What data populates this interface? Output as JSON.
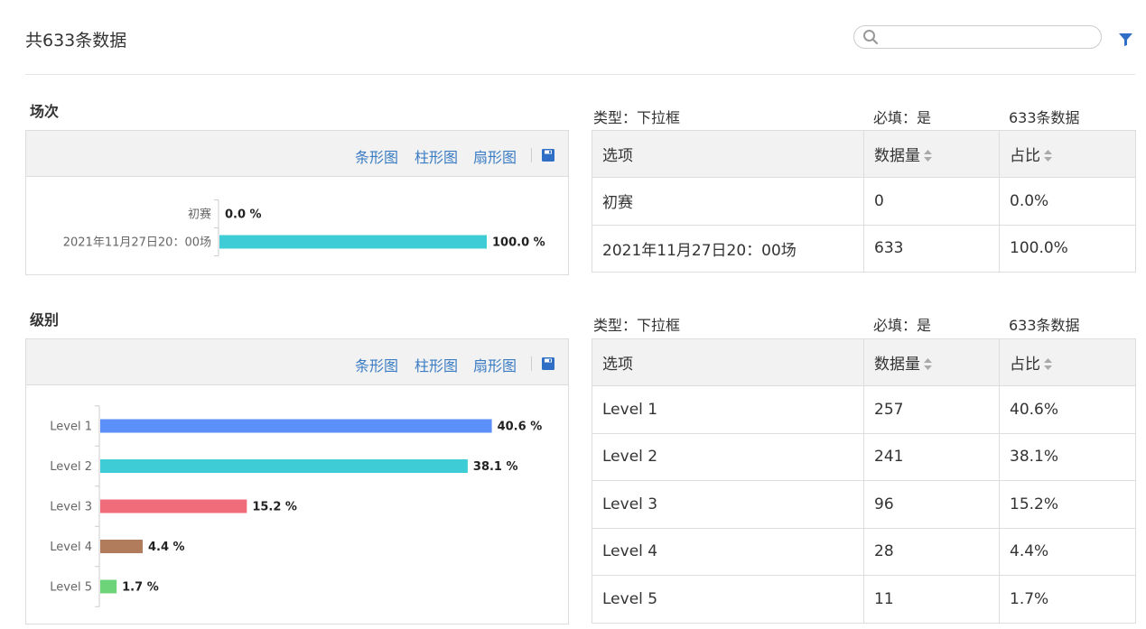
{
  "header": {
    "total_text": "共633条数据",
    "search": {
      "value": "",
      "placeholder": ""
    },
    "icons": {
      "search": "search-icon",
      "filter": "filter-icon"
    }
  },
  "toolbar": {
    "bar_label": "条形图",
    "column_label": "柱形图",
    "pie_label": "扇形图",
    "save_icon": "save-icon"
  },
  "colors": {
    "link": "#3a7cc4",
    "teal": "#3ecdd6",
    "blue": "#5b8ff9",
    "red": "#f06c7a",
    "brown": "#b07c5c",
    "green": "#6ed47a"
  },
  "sections": [
    {
      "title": "场次",
      "meta": {
        "type": "类型：下拉框",
        "required": "必填：是",
        "count": "633条数据"
      },
      "columns": [
        "选项",
        "数据量",
        "占比"
      ],
      "rows": [
        {
          "option": "初赛",
          "count": "0",
          "ratio": "0.0%"
        },
        {
          "option": "2021年11月27日20：00场",
          "count": "633",
          "ratio": "100.0%"
        }
      ]
    },
    {
      "title": "级别",
      "meta": {
        "type": "类型：下拉框",
        "required": "必填：是",
        "count": "633条数据"
      },
      "columns": [
        "选项",
        "数据量",
        "占比"
      ],
      "rows": [
        {
          "option": "Level 1",
          "count": "257",
          "ratio": "40.6%"
        },
        {
          "option": "Level 2",
          "count": "241",
          "ratio": "38.1%"
        },
        {
          "option": "Level 3",
          "count": "96",
          "ratio": "15.2%"
        },
        {
          "option": "Level 4",
          "count": "28",
          "ratio": "4.4%"
        },
        {
          "option": "Level 5",
          "count": "11",
          "ratio": "1.7%"
        }
      ]
    }
  ],
  "chart_data": [
    {
      "type": "bar",
      "orientation": "horizontal",
      "categories": [
        "初赛",
        "2021年11月27日20：00场"
      ],
      "values": [
        0.0,
        100.0
      ],
      "labels": [
        "0.0 %",
        "100.0 %"
      ],
      "colors": [
        "#3ecdd6",
        "#3ecdd6"
      ],
      "xlim": [
        0,
        100
      ]
    },
    {
      "type": "bar",
      "orientation": "horizontal",
      "categories": [
        "Level 1",
        "Level 2",
        "Level 3",
        "Level 4",
        "Level 5"
      ],
      "values": [
        40.6,
        38.1,
        15.2,
        4.4,
        1.7
      ],
      "labels": [
        "40.6 %",
        "38.1 %",
        "15.2 %",
        "4.4 %",
        "1.7 %"
      ],
      "colors": [
        "#5b8ff9",
        "#3ecdd6",
        "#f06c7a",
        "#b07c5c",
        "#6ed47a"
      ],
      "xlim": [
        0,
        100
      ]
    }
  ]
}
